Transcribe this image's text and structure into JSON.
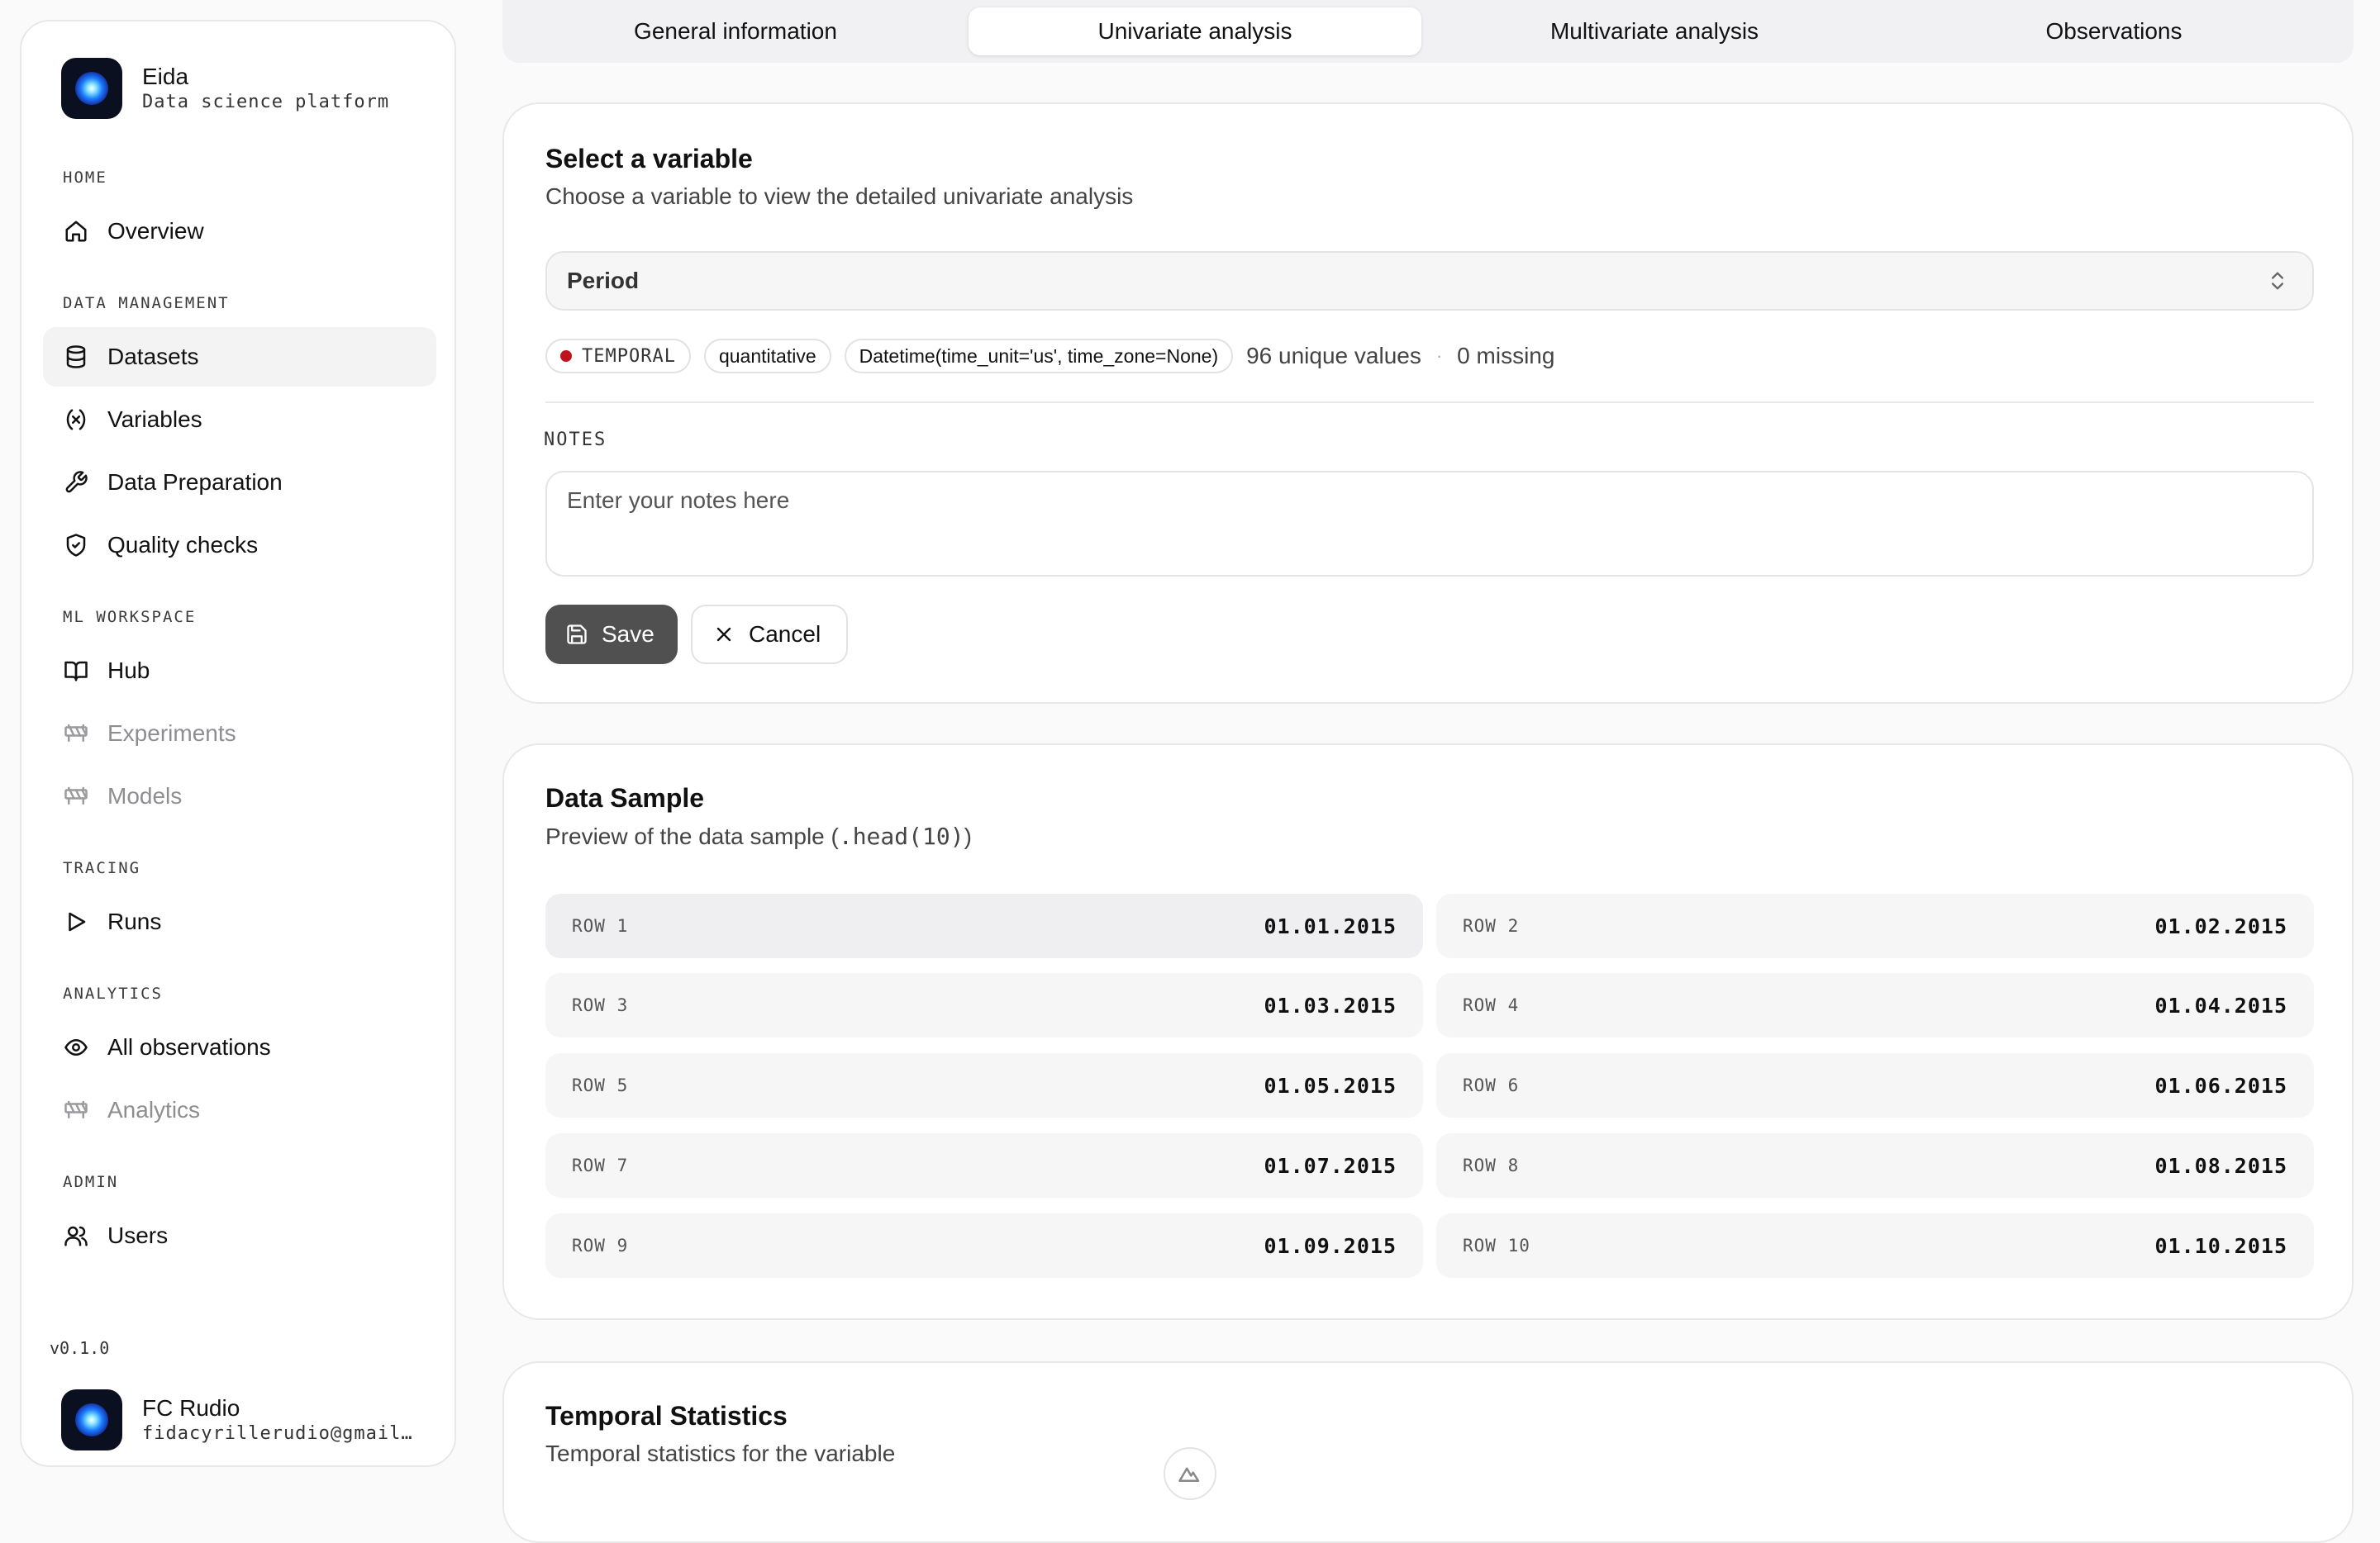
{
  "brand": {
    "name": "Eida",
    "subtitle": "Data science platform"
  },
  "sidebar": {
    "sections": {
      "home": "HOME",
      "data_management": "DATA MANAGEMENT",
      "ml_workspace": "ML WORKSPACE",
      "tracing": "TRACING",
      "analytics": "ANALYTICS",
      "admin": "ADMIN"
    },
    "items": {
      "overview": "Overview",
      "datasets": "Datasets",
      "variables": "Variables",
      "data_preparation": "Data Preparation",
      "quality_checks": "Quality checks",
      "hub": "Hub",
      "experiments": "Experiments",
      "models": "Models",
      "runs": "Runs",
      "all_observations": "All observations",
      "analytics": "Analytics",
      "users": "Users"
    },
    "active_item": "datasets",
    "disabled_items": [
      "experiments",
      "models",
      "analytics"
    ],
    "version": "v0.1.0"
  },
  "user": {
    "name": "FC Rudio",
    "email": "fidacyrillerudio@gmail.com"
  },
  "tabs": {
    "general": "General information",
    "univariate": "Univariate analysis",
    "multivariate": "Multivariate analysis",
    "observations": "Observations",
    "active": "univariate"
  },
  "variable_card": {
    "title": "Select a variable",
    "subtitle": "Choose a variable to view the detailed univariate analysis",
    "selected_variable": "Period",
    "badges": {
      "kind": "TEMPORAL",
      "kind_color": "#c0121b",
      "measure": "quantitative",
      "dtype": "Datetime(time_unit='us', time_zone=None)"
    },
    "unique_values": "96 unique values",
    "separator": "·",
    "missing": "0 missing",
    "notes_label": "NOTES",
    "notes_placeholder": "Enter your notes here",
    "notes_value": "",
    "save_label": "Save",
    "cancel_label": "Cancel"
  },
  "sample_card": {
    "title": "Data Sample",
    "subtitle_prefix": "Preview of the data sample (",
    "subtitle_code": ".head(10)",
    "subtitle_suffix": ")",
    "rows": [
      {
        "label": "ROW 1",
        "value": "01.01.2015"
      },
      {
        "label": "ROW 2",
        "value": "01.02.2015"
      },
      {
        "label": "ROW 3",
        "value": "01.03.2015"
      },
      {
        "label": "ROW 4",
        "value": "01.04.2015"
      },
      {
        "label": "ROW 5",
        "value": "01.05.2015"
      },
      {
        "label": "ROW 6",
        "value": "01.06.2015"
      },
      {
        "label": "ROW 7",
        "value": "01.07.2015"
      },
      {
        "label": "ROW 8",
        "value": "01.08.2015"
      },
      {
        "label": "ROW 9",
        "value": "01.09.2015"
      },
      {
        "label": "ROW 10",
        "value": "01.10.2015"
      }
    ]
  },
  "temporal_card": {
    "title": "Temporal Statistics",
    "subtitle": "Temporal statistics for the variable"
  },
  "icons": {
    "overview": "home-icon",
    "datasets": "database-icon",
    "variables": "variable-icon",
    "data_preparation": "wrench-icon",
    "quality_checks": "shield-check-icon",
    "hub": "book-open-icon",
    "experiments": "construction-icon",
    "models": "construction-icon",
    "runs": "play-icon",
    "all_observations": "eye-icon",
    "analytics": "construction-icon",
    "users": "users-icon"
  }
}
